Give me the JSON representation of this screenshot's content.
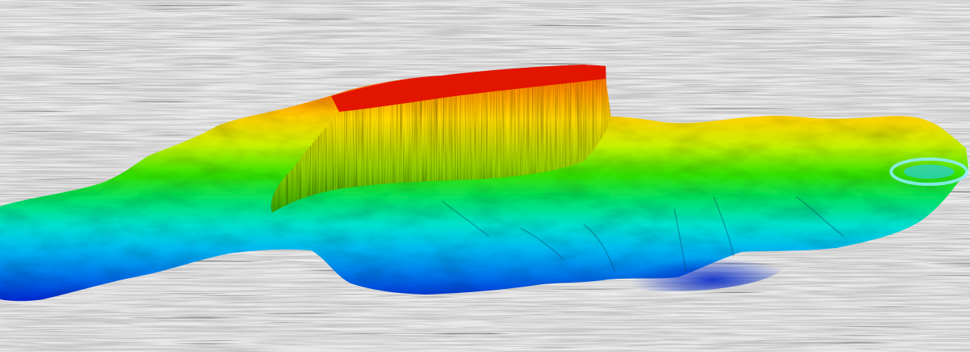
{
  "scene": {
    "subject": "seismic-horizon-surface",
    "colormap": [
      "#e00000",
      "#ff6a00",
      "#ffd000",
      "#c8f000",
      "#38e000",
      "#00e070",
      "#00e0d0",
      "#00b8f0",
      "#0070e8",
      "#0028d0"
    ],
    "background": {
      "base": "#8a8a8a",
      "light": "#f0f0f0",
      "dark": "#1e1e1e"
    }
  }
}
